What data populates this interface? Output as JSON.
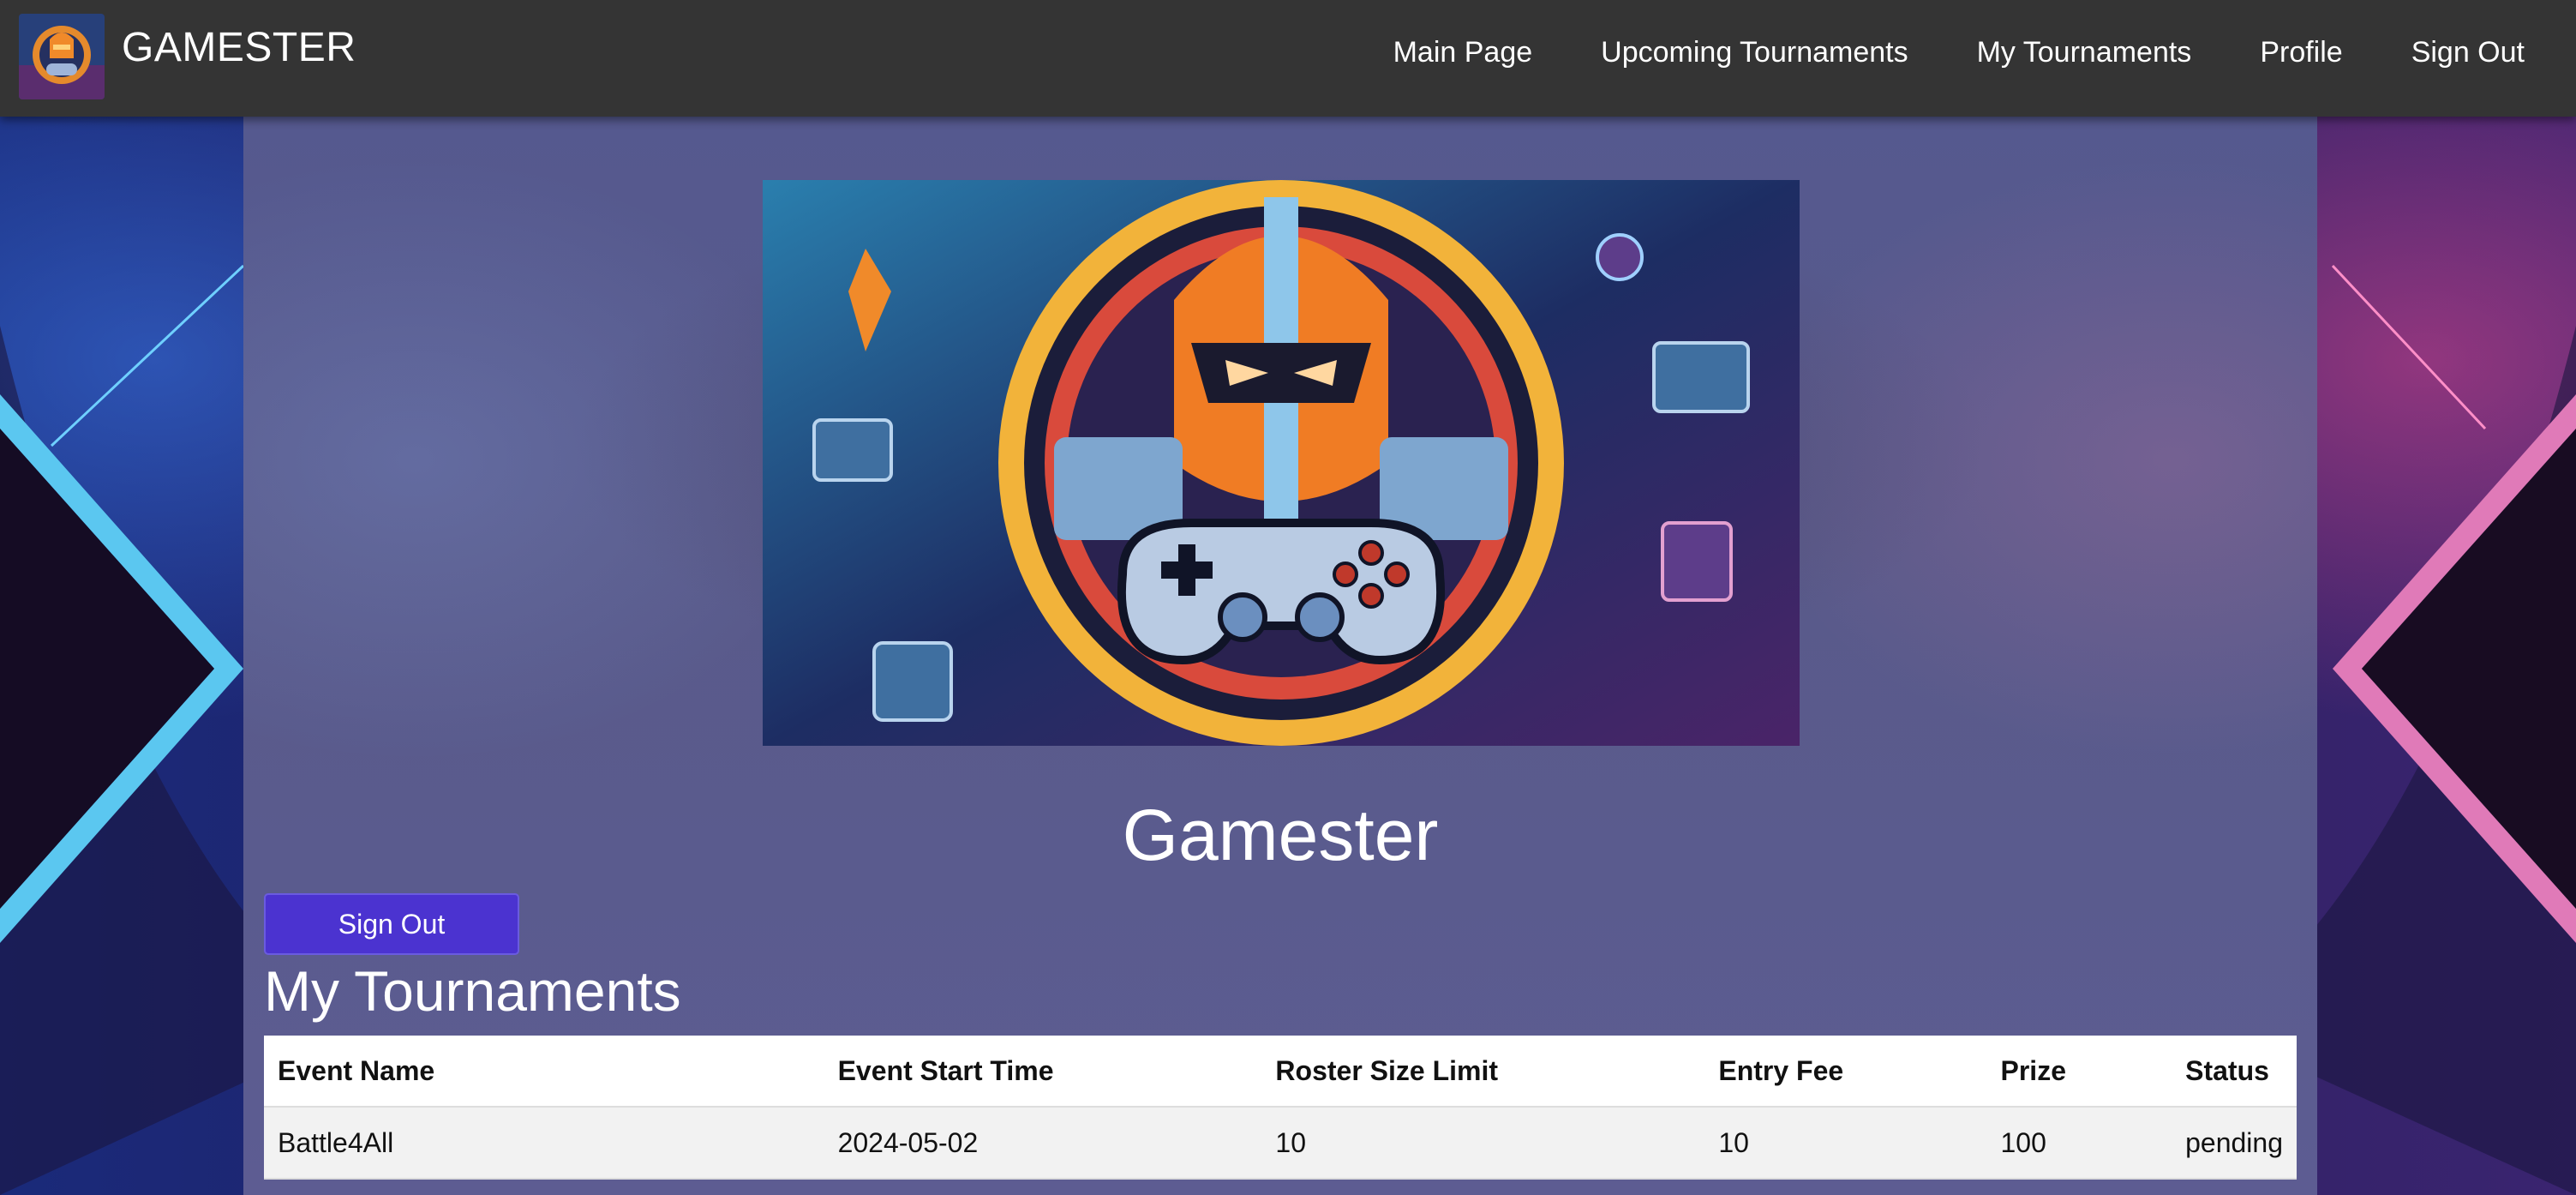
{
  "brand": {
    "name": "GAMESTER",
    "logo_icon": "gamester-logo-icon"
  },
  "nav": {
    "items": [
      {
        "label": "Main Page"
      },
      {
        "label": "Upcoming Tournaments"
      },
      {
        "label": "My Tournaments"
      },
      {
        "label": "Profile"
      },
      {
        "label": "Sign Out"
      }
    ]
  },
  "hero": {
    "image": "gamester-robot-controller-illustration"
  },
  "main": {
    "site_title": "Gamester",
    "signout_label": "Sign Out",
    "section_title": "My Tournaments",
    "table": {
      "headers": [
        "Event Name",
        "Event Start Time",
        "Roster Size Limit",
        "Entry Fee",
        "Prize",
        "Status"
      ],
      "rows": [
        [
          "Battle4All",
          "2024-05-02",
          "10",
          "10",
          "100",
          "pending"
        ]
      ]
    }
  },
  "colors": {
    "navbar": "#343434",
    "button": "#4b33d0",
    "left_accent": "#5bc7f0",
    "right_accent": "#e07ab8"
  }
}
